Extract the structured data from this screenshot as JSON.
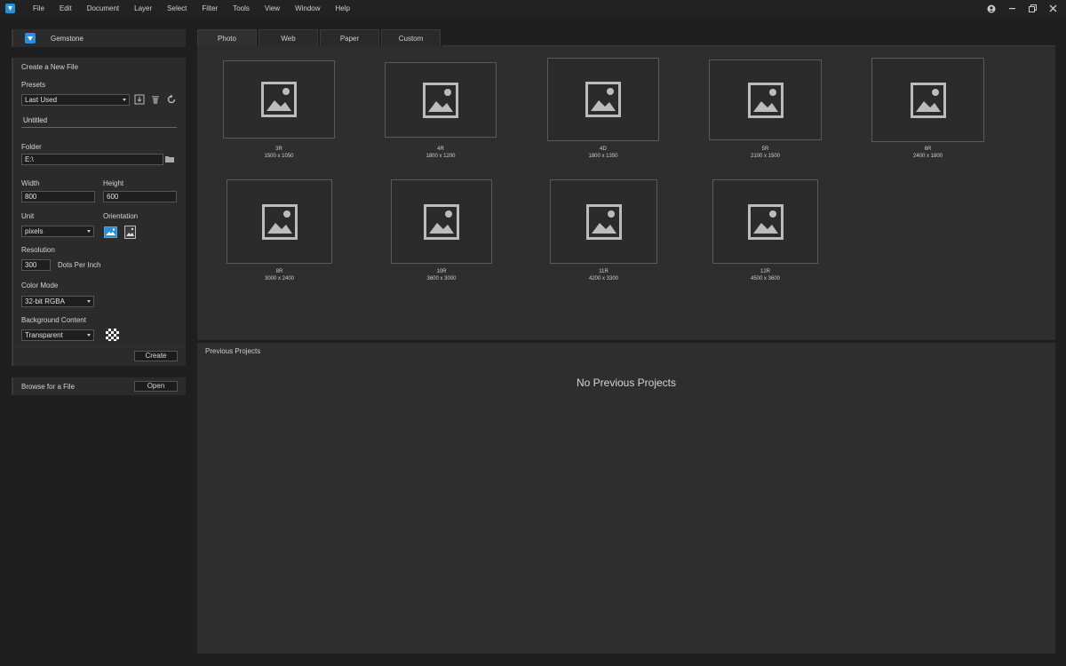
{
  "menu": [
    "File",
    "Edit",
    "Document",
    "Layer",
    "Select",
    "Filter",
    "Tools",
    "View",
    "Window",
    "Help"
  ],
  "app": {
    "title": "Gemstone"
  },
  "new_file": {
    "heading": "Create a New File",
    "presets_label": "Presets",
    "preset_value": "Last Used",
    "name_value": "Untitled",
    "folder_label": "Folder",
    "folder_value": "E:\\",
    "width_label": "Width",
    "width_value": "800",
    "height_label": "Height",
    "height_value": "600",
    "unit_label": "Unit",
    "unit_value": "pixels",
    "orientation_label": "Orientation",
    "resolution_label": "Resolution",
    "resolution_value": "300",
    "resolution_unit": "Dots Per Inch",
    "color_mode_label": "Color Mode",
    "color_mode_value": "32-bit RGBA",
    "background_label": "Background Content",
    "background_value": "Transparent",
    "create_button": "Create"
  },
  "browse": {
    "label": "Browse for a File",
    "open_button": "Open"
  },
  "tabs": [
    "Photo",
    "Web",
    "Paper",
    "Custom"
  ],
  "presets": [
    {
      "name": "3R",
      "size": "1500 x 1050"
    },
    {
      "name": "4R",
      "size": "1800 x 1200"
    },
    {
      "name": "4D",
      "size": "1800 x 1350"
    },
    {
      "name": "5R",
      "size": "2100 x 1500"
    },
    {
      "name": "6R",
      "size": "2400 x 1800"
    },
    {
      "name": "8R",
      "size": "3000 x 2400"
    },
    {
      "name": "10R",
      "size": "3600 x 3000"
    },
    {
      "name": "11R",
      "size": "4200 x 3300"
    },
    {
      "name": "12R",
      "size": "4500 x 3600"
    }
  ],
  "previous": {
    "title": "Previous Projects",
    "empty_text": "No Previous Projects"
  },
  "colors": {
    "accent": "#2a8fd6",
    "panel": "#2b2b2b",
    "background": "#1f1f1f"
  }
}
